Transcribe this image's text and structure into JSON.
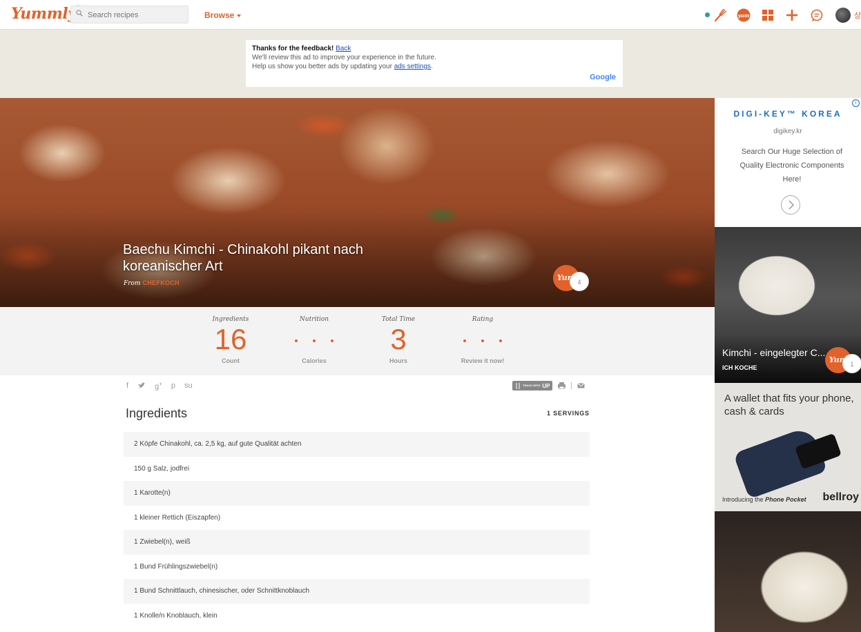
{
  "header": {
    "logo": "Yummly",
    "logo_tm": "™",
    "search_placeholder": "Search recipes",
    "browse_label": "Browse",
    "avatar_label": "상"
  },
  "ad_notice": {
    "thanks": "Thanks for the feedback!",
    "back_link": "Back",
    "line2": "We'll review this ad to improve your experience in the future.",
    "line3_prefix": "Help us show you better ads by updating your",
    "ads_settings_link": "ads settings",
    "line3_suffix": ".",
    "google": "Google"
  },
  "recipe": {
    "title": "Baechu Kimchi - Chinakohl pikant nach koreanischer Art",
    "from_label": "From",
    "source": "CHEFKOCH",
    "yum_label": "Yum",
    "yum_count": "4"
  },
  "stats": [
    {
      "heading": "Ingredients",
      "value": "16",
      "footer": "Count"
    },
    {
      "heading": "Nutrition",
      "value": "",
      "footer": "Calories"
    },
    {
      "heading": "Total Time",
      "value": "3",
      "footer": "Hours"
    },
    {
      "heading": "Rating",
      "value": "",
      "footer": "Review it now!"
    }
  ],
  "share_icons": [
    "facebook-icon",
    "twitter-icon",
    "google-plus-icon",
    "pinterest-icon",
    "stumbleupon-icon"
  ],
  "tools": {
    "track_small": "TRACK WITH",
    "track_big": "UP"
  },
  "ingredients": {
    "title": "Ingredients",
    "servings": "1 SERVINGS",
    "items": [
      "2 Köpfe Chinakohl, ca. 2,5 kg, auf gute Qualität achten",
      "150 g Salz, jodfrei",
      "1 Karotte(n)",
      "1 kleiner Rettich (Eiszapfen)",
      "1 Zwiebel(n), weiß",
      "1 Bund Frühlingszwiebel(n)",
      "1 Bund Schnittlauch, chinesischer, oder Schnittknoblauch",
      "1 Knolle/n Knoblauch, klein"
    ]
  },
  "rail": {
    "ad1": {
      "brand": "DIGI-KEY™ KOREA",
      "url": "digikey.kr",
      "text": "Search Our Huge Selection of Quality Electronic Components Here!"
    },
    "card": {
      "title": "Kimchi - eingelegter C...",
      "source": "ICH KOCHE",
      "yum_label": "Yum",
      "yum_count": "1"
    },
    "ad2": {
      "headline": "A wallet that fits your phone, cash & cards",
      "intro_prefix": "Introducing the",
      "intro_product": "Phone Pocket",
      "brand": "bellroy"
    }
  },
  "colors": {
    "accent": "#e1622b",
    "status_dot": "#2aa198"
  }
}
